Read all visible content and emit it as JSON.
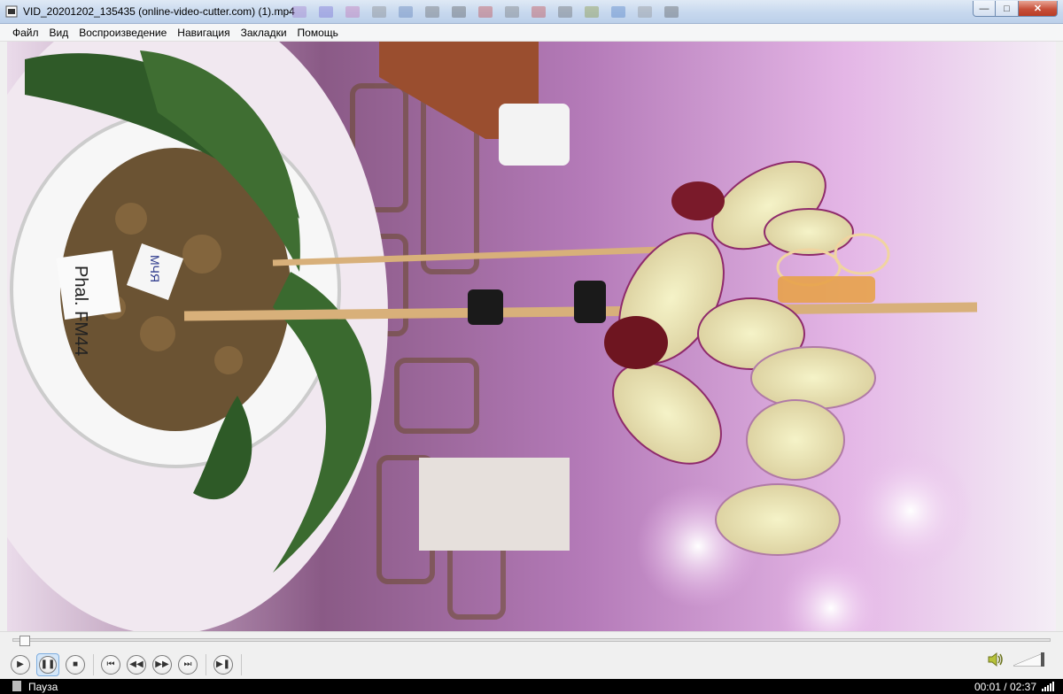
{
  "window": {
    "title": "VID_20201202_135435 (online-video-cutter.com) (1).mp4",
    "buttons": {
      "minimize": "—",
      "maximize": "□",
      "close": "✕"
    }
  },
  "menu": [
    "Файл",
    "Вид",
    "Воспроизведение",
    "Навигация",
    "Закладки",
    "Помощь"
  ],
  "video": {
    "pot_labels": [
      "Phal. FM44",
      "МЧЯ"
    ]
  },
  "controls": {
    "seek_position": 0.007,
    "buttons": [
      {
        "name": "play-button",
        "icon": "play-icon",
        "glyph": "▶"
      },
      {
        "name": "pause-button",
        "icon": "pause-icon",
        "glyph": "❚❚",
        "pressed": true
      },
      {
        "name": "stop-button",
        "icon": "stop-icon",
        "glyph": "■"
      },
      {
        "name": "previous-button",
        "icon": "skip-back-icon",
        "glyph": "⏮"
      },
      {
        "name": "rewind-button",
        "icon": "rewind-icon",
        "glyph": "◀◀"
      },
      {
        "name": "forward-button",
        "icon": "fast-forward-icon",
        "glyph": "▶▶"
      },
      {
        "name": "next-button",
        "icon": "skip-forward-icon",
        "glyph": "⏭"
      },
      {
        "name": "frame-step-button",
        "icon": "frame-step-icon",
        "glyph": "▶❚"
      }
    ],
    "volume_level": 1.0
  },
  "status": {
    "state": "Пауза",
    "time": "00:01 / 02:37"
  },
  "colors": {
    "accent": "#7eaee0",
    "video_bg": "#c48fbf"
  }
}
